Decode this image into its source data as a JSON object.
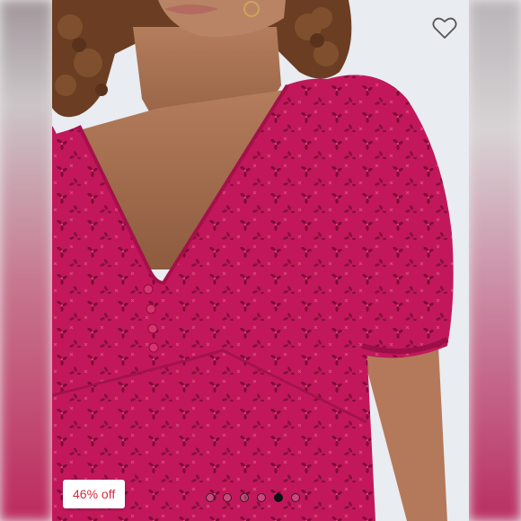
{
  "listing": {
    "discount_label": "46% off",
    "image_count": 6,
    "active_image_index": 4,
    "heart_icon": "heart-outline-icon",
    "garment_color": "#c2185b"
  }
}
